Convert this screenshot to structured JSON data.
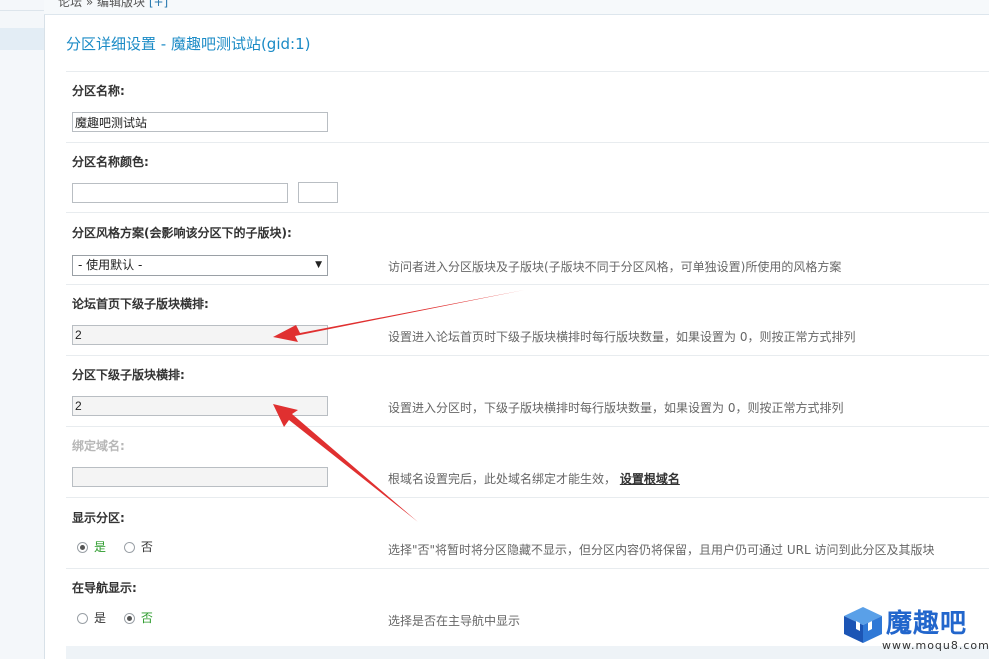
{
  "breadcrumb": {
    "path": "论坛 » 编辑版块",
    "plus": "[+]"
  },
  "panel": {
    "title": "分区详细设置 - 魔趣吧测试站(gid:1)"
  },
  "fields": {
    "name": {
      "label": "分区名称:",
      "value": "魔趣吧测试站"
    },
    "name_color": {
      "label": "分区名称颜色:",
      "value": ""
    },
    "style": {
      "label": "分区风格方案(会影响该分区下的子版块):",
      "selected": "- 使用默认 -",
      "desc": "访问者进入分区版块及子版块(子版块不同于分区风格，可单独设置)所使用的风格方案"
    },
    "index_sub_columns": {
      "label": "论坛首页下级子版块横排:",
      "value": "2",
      "desc": "设置进入论坛首页时下级子版块横排时每行版块数量，如果设置为 0，则按正常方式排列"
    },
    "sub_columns": {
      "label": "分区下级子版块横排:",
      "value": "2",
      "desc": "设置进入分区时，下级子版块横排时每行版块数量，如果设置为 0，则按正常方式排列"
    },
    "domain": {
      "label": "绑定域名:",
      "value": "",
      "desc": "根域名设置完后，此处域名绑定才能生效，",
      "link": "设置根域名"
    },
    "show": {
      "label": "显示分区:",
      "options": [
        "是",
        "否"
      ],
      "selected": "是",
      "desc": "选择\"否\"将暂时将分区隐藏不显示，但分区内容仍将保留，且用户仍可通过 URL 访问到此分区及其版块"
    },
    "nav": {
      "label": "在导航显示:",
      "options": [
        "是",
        "否"
      ],
      "selected": "否",
      "desc": "选择是否在主导航中显示"
    }
  },
  "watermark": {
    "title": "魔趣吧",
    "url": "www.moqu8.com"
  },
  "colors": {
    "title": "#1b8bc6",
    "annotation_arrow": "#e03030",
    "selected_option": "#2a9a2a"
  }
}
